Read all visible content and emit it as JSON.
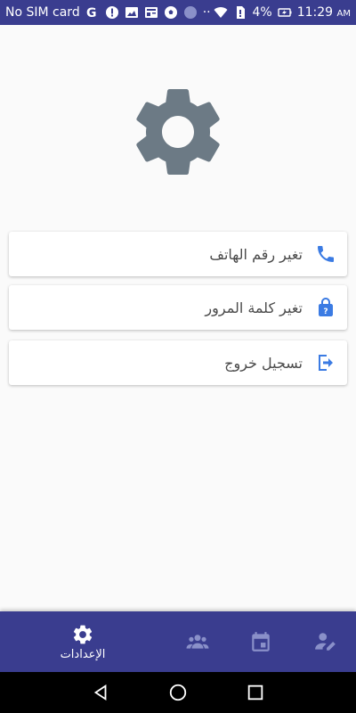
{
  "status_bar": {
    "carrier": "No SIM card",
    "battery_percent": "4%",
    "time": "11:29",
    "ampm": "AM",
    "dots": "··"
  },
  "settings_menu": [
    {
      "label": "تغير رقم الهاتف",
      "icon": "phone-icon"
    },
    {
      "label": "تغير كلمة المرور",
      "icon": "lock-icon"
    },
    {
      "label": "تسجيل خروج",
      "icon": "logout-icon"
    }
  ],
  "bottom_nav": {
    "settings_label": "الإعدادات",
    "active": "settings",
    "items": [
      "settings-icon",
      "groups-icon",
      "calendar-icon",
      "edit-icon"
    ]
  },
  "colors": {
    "primary": "#3a3d8f",
    "accent": "#3b7be3",
    "gear": "#6c7a85"
  }
}
